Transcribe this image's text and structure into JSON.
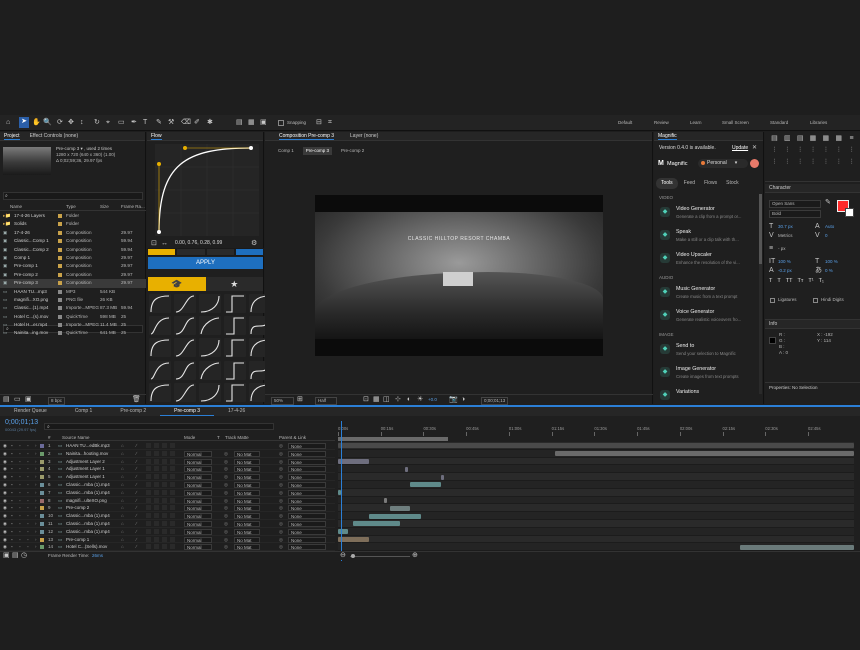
{
  "toolbar": {
    "snapping_label": "Snapping",
    "workspaces": [
      "Default",
      "Review",
      "Learn",
      "Small Screen",
      "Standard",
      "Libraries"
    ]
  },
  "project": {
    "tab_project": "Project",
    "tab_effect_controls": "Effect Controls (none)",
    "selected_name": "Pre-comp 3 ▾ , used 2 times",
    "selected_res": "1280 x 720 (640 x 360) (1.00)",
    "selected_duration": "Δ 0;02;59;36, 29.97 fps",
    "search_placeholder": "",
    "columns": [
      "Name",
      "Type",
      "Size",
      "Frame Ra..."
    ],
    "items": [
      {
        "name": "17-4-26 Layers",
        "type": "Folder",
        "size": "",
        "fps": "",
        "color": "#c9a24a",
        "kind": "folder"
      },
      {
        "name": "Solids",
        "type": "Folder",
        "size": "",
        "fps": "",
        "color": "#c9a24a",
        "kind": "folder"
      },
      {
        "name": "17-4-26",
        "type": "Composition",
        "size": "",
        "fps": "29.97",
        "color": "#c9a24a",
        "kind": "comp"
      },
      {
        "name": "Classic...Comp 1",
        "type": "Composition",
        "size": "",
        "fps": "59.94",
        "color": "#c9a24a",
        "kind": "comp"
      },
      {
        "name": "Classic...Comp 2",
        "type": "Composition",
        "size": "",
        "fps": "59.94",
        "color": "#c9a24a",
        "kind": "comp"
      },
      {
        "name": "Comp 1",
        "type": "Composition",
        "size": "",
        "fps": "29.97",
        "color": "#c9a24a",
        "kind": "comp"
      },
      {
        "name": "Pre-comp 1",
        "type": "Composition",
        "size": "",
        "fps": "29.97",
        "color": "#c9a24a",
        "kind": "comp"
      },
      {
        "name": "Pre-comp 2",
        "type": "Composition",
        "size": "",
        "fps": "29.97",
        "color": "#c9a24a",
        "kind": "comp"
      },
      {
        "name": "Pre-comp 3",
        "type": "Composition",
        "size": "",
        "fps": "29.97",
        "color": "#c9a24a",
        "kind": "comp"
      },
      {
        "name": "HAAN TU...mp3",
        "type": "MP3",
        "size": "544 KB",
        "fps": "",
        "color": "#8a8a8a",
        "kind": "file"
      },
      {
        "name": "magnifi...XO.png",
        "type": "PNG file",
        "size": "26 KB",
        "fps": "",
        "color": "#8a8a8a",
        "kind": "file"
      },
      {
        "name": "Classic...(1).mp4",
        "type": "Importe...MPEG",
        "size": "87.3 MB",
        "fps": "59.94",
        "color": "#8a8a8a",
        "kind": "file"
      },
      {
        "name": "Hotel C...(s).mov",
        "type": "QuickTime",
        "size": "598 MB",
        "fps": "25",
        "color": "#8a8a8a",
        "kind": "file"
      },
      {
        "name": "Hotel H...er.mp4",
        "type": "Importe...MPEG",
        "size": "11.4 MB",
        "fps": "25",
        "color": "#8a8a8a",
        "kind": "file"
      },
      {
        "name": "Nainita...ing.mov",
        "type": "QuickTime",
        "size": "641 MB",
        "fps": "25",
        "color": "#8a8a8a",
        "kind": "file"
      }
    ],
    "bpc": "8 bpc"
  },
  "flow": {
    "title": "Flow",
    "curve_values": "0.00, 0.76, 0.28, 0.99",
    "apply_label": "APPLY"
  },
  "composition": {
    "tab_label": "Composition Pre-comp 3",
    "layer_tab": "Layer (none)",
    "breadcrumbs": [
      "Comp 1",
      "Pre-comp 3",
      "Pre-comp 2"
    ],
    "video_text": "CLASSIC HILLTOP RESORT CHAMBA",
    "zoom": "50%",
    "resolution": "Half",
    "exposure": "+0.0",
    "timecode": "0;00;01;13"
  },
  "magnific": {
    "title": "Magnific",
    "version_text": "Version 0.4.0 is available.",
    "update_label": "Update",
    "brand": "Magnific",
    "plan": "Personal",
    "tabs": [
      "Tools",
      "Feed",
      "Flows",
      "Stock"
    ],
    "sections": [
      {
        "heading": "VIDEO",
        "items": [
          {
            "title": "Video Generator",
            "desc": "Generate a clip from a prompt or...",
            "icon": "video-generator-icon"
          },
          {
            "title": "Speak",
            "desc": "Make a still or a clip talk with th...",
            "icon": "speak-icon"
          },
          {
            "title": "Video Upscaler",
            "desc": "Enhance the resolution of the vi...",
            "icon": "video-upscaler-icon"
          }
        ]
      },
      {
        "heading": "AUDIO",
        "items": [
          {
            "title": "Music Generator",
            "desc": "Create music from a text prompt",
            "icon": "music-generator-icon"
          },
          {
            "title": "Voice Generator",
            "desc": "Generate realistic voiceovers fro...",
            "icon": "voice-generator-icon"
          }
        ]
      },
      {
        "heading": "IMAGE",
        "items": [
          {
            "title": "Send to",
            "desc": "Send your selection to Magnific",
            "icon": "send-to-icon"
          },
          {
            "title": "Image Generator",
            "desc": "Create images from text prompts",
            "icon": "image-generator-icon"
          },
          {
            "title": "Variations",
            "desc": "",
            "icon": "variations-icon"
          }
        ]
      }
    ]
  },
  "character": {
    "title": "Character",
    "font": "Open Sans",
    "style": "Bold",
    "size": "30.7 px",
    "leading": "Auto",
    "kerning": "Metrics",
    "tracking": "0",
    "stroke_unit": "- px",
    "vscale": "100 %",
    "hscale": "100 %",
    "baseline": "-0.2 px",
    "tsume": "0 %",
    "ligatures": "Ligatures",
    "hindi_digits": "Hindi Digits",
    "fill_color": "#ff2a2a"
  },
  "info": {
    "title": "Info",
    "r": "R :",
    "g": "G :",
    "b": "B :",
    "a": "A : 0",
    "x": "X : -192",
    "y": "Y : 114"
  },
  "properties": {
    "title": "Properties: No Selection"
  },
  "timeline": {
    "tabs": [
      "Render Queue",
      "Comp 1",
      "Pre-comp 2",
      "Pre-comp 3",
      "17-4-26"
    ],
    "timecode": "0;00;01;13",
    "timecode_sub": "00043 (29.97 fps)",
    "columns": [
      "#",
      "Source Name",
      "Mode",
      "T",
      "Track Matte",
      "Parent & Link"
    ],
    "ruler": [
      "0:00s",
      "00:15s",
      "00:30s",
      "00:45s",
      "01:00s",
      "01:15s",
      "01:30s",
      "01:45s",
      "02:00s",
      "02:15s",
      "02:30s",
      "02:45s"
    ],
    "footer": "Frame Render Time:",
    "render_time": "26ms",
    "layers": [
      {
        "num": "1",
        "name": "HAAN TU...edBk.mp3",
        "color": "#6b6b9a",
        "mode": "",
        "matte": "",
        "parent": "None",
        "bar": [
          0.0,
          1.0
        ],
        "barcolor": "#4a4a4a"
      },
      {
        "num": "2",
        "name": "Nainita...hooting.mov",
        "color": "#6b9a6b",
        "mode": "Normal",
        "matte": "No Mat",
        "parent": "None",
        "bar": [
          0.42,
          1.0
        ],
        "barcolor": "#6a6a6a"
      },
      {
        "num": "3",
        "name": "Adjustment Layer 2",
        "color": "#9a9a6b",
        "mode": "Normal",
        "matte": "No Mat",
        "parent": "None",
        "bar": [
          0.0,
          0.06
        ],
        "barcolor": "#6e6e7e"
      },
      {
        "num": "4",
        "name": "Adjustment Layer 1",
        "color": "#9a9a6b",
        "mode": "Normal",
        "matte": "No Mat",
        "parent": "None",
        "bar": [
          0.13,
          0.135
        ],
        "barcolor": "#6e6e7e"
      },
      {
        "num": "5",
        "name": "Adjustment Layer 1",
        "color": "#9a9a6b",
        "mode": "Normal",
        "matte": "No Mat",
        "parent": "None",
        "bar": [
          0.2,
          0.205
        ],
        "barcolor": "#6e6e7e"
      },
      {
        "num": "6",
        "name": "Classic...mba (1).mp4",
        "color": "#6b8f9a",
        "mode": "Normal",
        "matte": "No Mat",
        "parent": "None",
        "bar": [
          0.14,
          0.2
        ],
        "barcolor": "#5f8a8a"
      },
      {
        "num": "7",
        "name": "Classic...mba (1).mp4",
        "color": "#6b8f9a",
        "mode": "Normal",
        "matte": "No Mat",
        "parent": "None",
        "bar": [
          0.0,
          0.005
        ],
        "barcolor": "#5f8a8a"
      },
      {
        "num": "8",
        "name": "magnifi...ulteXO.png",
        "color": "#9a6b6b",
        "mode": "Normal",
        "matte": "No Mat",
        "parent": "None",
        "bar": [
          0.09,
          0.09
        ],
        "barcolor": "#7a7a7a"
      },
      {
        "num": "9",
        "name": "Pre-comp 2",
        "color": "#c9a24a",
        "mode": "Normal",
        "matte": "No Mat",
        "parent": "None",
        "bar": [
          0.1,
          0.14
        ],
        "barcolor": "#6e7e7e"
      },
      {
        "num": "10",
        "name": "Classic...mba (1).mp4",
        "color": "#6b8f9a",
        "mode": "Normal",
        "matte": "No Mat",
        "parent": "None",
        "bar": [
          0.06,
          0.16
        ],
        "barcolor": "#5f8a8a"
      },
      {
        "num": "11",
        "name": "Classic...mba (1).mp4",
        "color": "#6b8f9a",
        "mode": "Normal",
        "matte": "No Mat",
        "parent": "None",
        "bar": [
          0.03,
          0.12
        ],
        "barcolor": "#5f8a8a"
      },
      {
        "num": "12",
        "name": "Classic...mba (1).mp4",
        "color": "#6b8f9a",
        "mode": "Normal",
        "matte": "No Mat",
        "parent": "None",
        "bar": [
          0.0,
          0.02
        ],
        "barcolor": "#5f8a8a"
      },
      {
        "num": "13",
        "name": "Pre-comp 1",
        "color": "#c9a24a",
        "mode": "Normal",
        "matte": "No Mat",
        "parent": "None",
        "bar": [
          0.0,
          0.06
        ],
        "barcolor": "#7e6e5a"
      },
      {
        "num": "14",
        "name": "Hotel C...(Sells).mov",
        "color": "#6b9a6b",
        "mode": "Normal",
        "matte": "No Mat",
        "parent": "None",
        "bar": [
          0.78,
          1.0
        ],
        "barcolor": "#6a7a7a"
      }
    ]
  }
}
